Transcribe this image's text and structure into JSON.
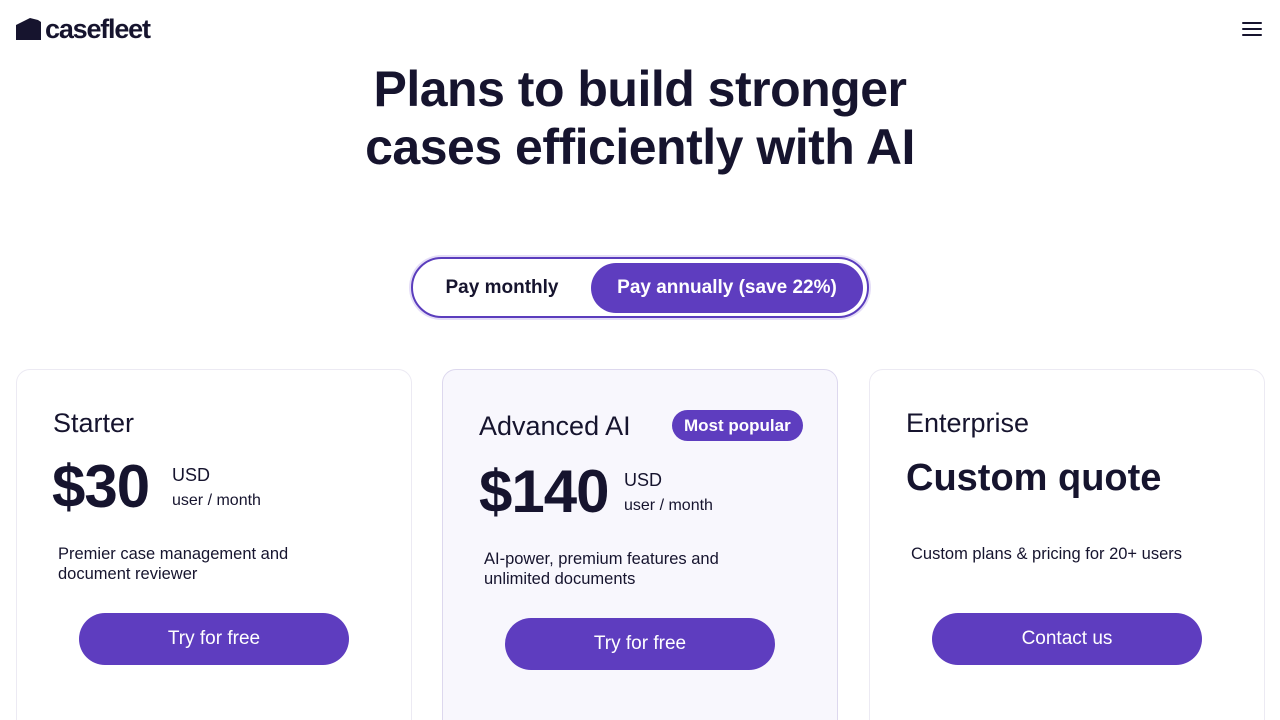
{
  "header": {
    "logo_text": "casefleet",
    "menu_icon": "hamburger-menu-icon"
  },
  "hero": {
    "title_line1": "Plans to build stronger",
    "title_line2": "cases efficiently with AI"
  },
  "billing_toggle": {
    "monthly_label": "Pay monthly",
    "annual_label": "Pay annually (save 22%)",
    "selected": "annual"
  },
  "plans": [
    {
      "name": "Starter",
      "price": "$30",
      "currency": "USD",
      "unit": "user / month",
      "description": "Premier case management and document reviewer",
      "cta": "Try for free"
    },
    {
      "name": "Advanced AI",
      "badge": "Most popular",
      "price": "$140",
      "currency": "USD",
      "unit": "user / month",
      "description": "AI-power, premium features and unlimited documents",
      "cta": "Try for free"
    },
    {
      "name": "Enterprise",
      "price": "Custom quote",
      "description": "Custom plans & pricing for 20+ users",
      "cta": "Contact us"
    }
  ],
  "colors": {
    "accent": "#5e3dbf",
    "text": "#16142e",
    "featured_card_bg": "#f8f7fd"
  }
}
